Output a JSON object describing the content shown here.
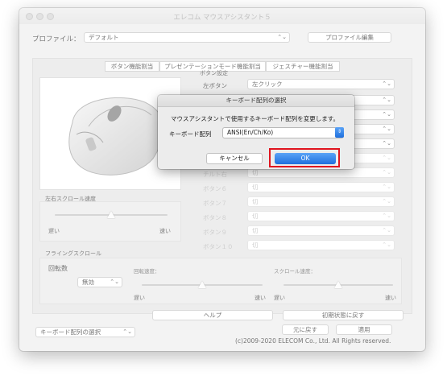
{
  "window": {
    "title": "エレコム マウスアシスタント５"
  },
  "profile": {
    "label": "プロファイル：",
    "value": "デフォルト",
    "edit_button": "プロファイル編集"
  },
  "tabs": [
    "ボタン機能割当",
    "プレゼンテーションモード機能割当",
    "ジェスチャー機能割当"
  ],
  "section": {
    "button_settings": "ボタン設定"
  },
  "buttons": [
    {
      "label": "左ボタン",
      "value": "左クリック",
      "enabled": true
    },
    {
      "label": "チルト右",
      "value": "切",
      "enabled": false
    },
    {
      "label": "ボタン６",
      "value": "切",
      "enabled": false
    },
    {
      "label": "ボタン７",
      "value": "切",
      "enabled": false
    },
    {
      "label": "ボタン８",
      "value": "切",
      "enabled": false
    },
    {
      "label": "ボタン９",
      "value": "切",
      "enabled": false
    },
    {
      "label": "ボタン１０",
      "value": "切",
      "enabled": false
    }
  ],
  "scroll_speed": {
    "title": "左右スクロール速度",
    "slow": "遅い",
    "fast": "速い",
    "level": 0.5
  },
  "flying_scroll": {
    "title": "フライングスクロール",
    "rotation_label": "回転数",
    "rotation_value": "無効",
    "rotation_speed": {
      "title": "回転速度：",
      "slow": "遅い",
      "fast": "速い",
      "level": 0.5
    },
    "scroll_speed": {
      "title": "スクロール速度：",
      "slow": "遅い",
      "fast": "速い",
      "level": 0.5
    }
  },
  "actions": {
    "help": "ヘルプ",
    "reset": "初期状態に戻す",
    "revert": "元に戻す",
    "apply": "適用"
  },
  "keyboard_select": {
    "value": "キーボード配列の選択"
  },
  "copyright": "(c)2009-2020 ELECOM Co., Ltd. All Rights reserved.",
  "dialog": {
    "title": "キーボード配列の選択",
    "message": "マウスアシスタントで使用するキーボード配列を変更します。",
    "field_label": "キーボード配列",
    "field_value": "ANSI(En/Ch/Ko)",
    "cancel": "キャンセル",
    "ok": "OK"
  },
  "colors": {
    "accent": "#1f6fdd",
    "highlight": "#e0141e"
  }
}
